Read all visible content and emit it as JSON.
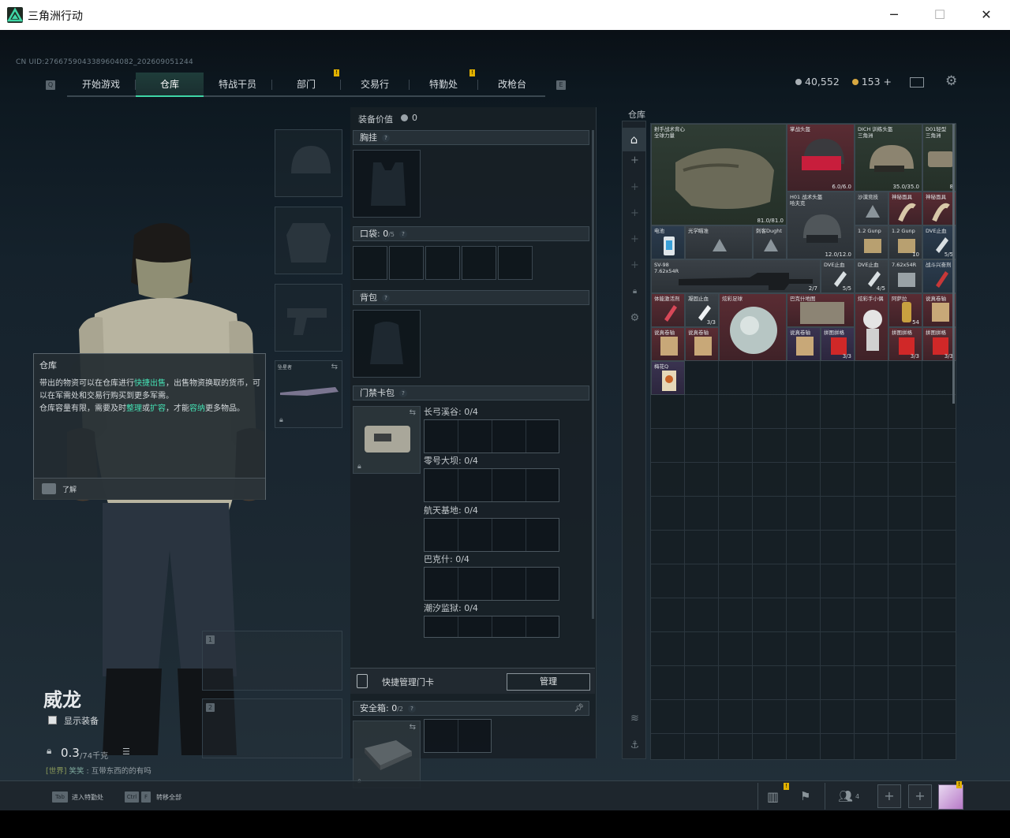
{
  "window": {
    "title": "三角洲行动",
    "minimize": "─",
    "maximize": "☐",
    "close": "✕"
  },
  "uid": "CN UID:2766759043389604082_202609051244",
  "nav": {
    "left_key": "Q",
    "right_key": "E",
    "tabs": [
      "开始游戏",
      "仓库",
      "特战干员",
      "部门",
      "交易行",
      "特勤处",
      "改枪台"
    ],
    "active_tab": "仓库"
  },
  "currency": {
    "coins": "40,552",
    "tokens": "153 +",
    "coin_color": "#a9b0b5",
    "token_color": "#d8a840"
  },
  "character": {
    "name": "威龙",
    "show_equipment": "显示装备",
    "weight": "0.3",
    "weight_max": "/74千克",
    "chat": "[世界] 笑笑 : 互带东西的的有吗",
    "chat_channel": "[世界]",
    "chat_user": "笑笑",
    "chat_msg": ": 互带东西的的有吗",
    "slot_label": "坠星者",
    "weapon_slot_1": "1",
    "weapon_slot_2": "2"
  },
  "tooltip": {
    "title": "仓库",
    "l1a": "带出的物资可以在仓库进行",
    "l1b": "快捷出售",
    "l1c": "，出售物资换取的货币，可以在军需处和交易行购买到更多军需。",
    "l2a": "仓库容量有限，需要及时",
    "l2b": "整理",
    "l2c": "或",
    "l2d": "扩容",
    "l2e": "，才能",
    "l2f": "容纳",
    "l2g": "更多物品。",
    "ack": "了解"
  },
  "center": {
    "equip_value_label": "装备价值",
    "equip_value": "0",
    "chest": "胸挂",
    "pocket_label": "口袋:",
    "pocket_count": "0",
    "pocket_max": "/5",
    "backpack": "背包",
    "keycard_bag": "门禁卡包",
    "maps": [
      {
        "name": "长弓溪谷: 0/4"
      },
      {
        "name": "零号大坝: 0/4"
      },
      {
        "name": "航天基地: 0/4"
      },
      {
        "name": "巴克什: 0/4"
      },
      {
        "name": "潮汐监狱: 0/4"
      }
    ],
    "quick_manage": "快捷管理门卡",
    "manage_btn": "管理",
    "safebox_label": "安全箱:",
    "safebox_count": "0",
    "safebox_max": "/2"
  },
  "warehouse": {
    "title": "仓库",
    "items": [
      {
        "name": "射手战术背心",
        "sub": "全球力量",
        "count": "81.0/81.0",
        "tone": "green"
      },
      {
        "name": "掌战头盔",
        "count": "6.0/6.0",
        "tone": "red"
      },
      {
        "name": "DICH 训练头盔",
        "sub": "三角洲",
        "count": "35.0/35.0",
        "tone": "green"
      },
      {
        "name": "D01轻型",
        "sub": "三角洲",
        "count": "8",
        "tone": "green"
      },
      {
        "name": "H01 战术头盔",
        "sub": "哈夫克",
        "count": "12.0/12.0",
        "tone": "gray"
      },
      {
        "name": "沙漠竞技",
        "count": "",
        "tone": "gray"
      },
      {
        "name": "神秘面具",
        "count": "",
        "tone": "red"
      },
      {
        "name": "神秘面具",
        "count": "",
        "tone": "red"
      },
      {
        "name": "电池",
        "count": "",
        "tone": "blue"
      },
      {
        "name": "光学瞄准",
        "count": "",
        "tone": "gray"
      },
      {
        "name": "刺客Dught",
        "count": "",
        "tone": "gray"
      },
      {
        "name": "1.2 Gunp",
        "count": "",
        "tone": "gray"
      },
      {
        "name": "1.2 Gunp",
        "count": "10",
        "tone": "gray"
      },
      {
        "name": "DVE止血",
        "count": "5/5",
        "tone": "blue"
      },
      {
        "name": "SV-98",
        "sub": "7.62x54R",
        "count": "2/7",
        "tone": "gray"
      },
      {
        "name": "DVE止血",
        "count": "5/5",
        "tone": "gray"
      },
      {
        "name": "DVE止血",
        "count": "4/5",
        "tone": "gray"
      },
      {
        "name": "7.62x54R",
        "count": "",
        "tone": "gray"
      },
      {
        "name": "战斗兴奋剂",
        "count": "",
        "tone": "blue"
      },
      {
        "name": "体能激活剂",
        "count": "",
        "tone": "red"
      },
      {
        "name": "凝固止血",
        "count": "3/3",
        "tone": "gray"
      },
      {
        "name": "炫彩足球",
        "count": "",
        "tone": "red"
      },
      {
        "name": "巴克什地图",
        "count": "",
        "tone": "red"
      },
      {
        "name": "炫彩手小偶",
        "count": "",
        "tone": "red"
      },
      {
        "name": "阿萨拉",
        "count": "54",
        "tone": "red"
      },
      {
        "name": "说真卷轴",
        "count": "",
        "tone": "red"
      },
      {
        "name": "说真卷轴",
        "count": "",
        "tone": "red"
      },
      {
        "name": "说真卷轴",
        "count": "",
        "tone": "red"
      },
      {
        "name": "说真卷轴",
        "count": "",
        "tone": "purple"
      },
      {
        "name": "拼图拼格",
        "count": "3/3",
        "tone": "purple"
      },
      {
        "name": "拼图拼格",
        "count": "3/3",
        "tone": "red"
      },
      {
        "name": "拼图拼格",
        "count": "3/3",
        "tone": "red"
      },
      {
        "name": "梅花Q",
        "count": "",
        "tone": "purple"
      }
    ]
  },
  "bottom": {
    "tab_key": "Tab",
    "tab_action": "进入特勤处",
    "ctrl_key": "Ctrl",
    "f_key": "F",
    "transfer_action": "转移全部",
    "team_count": "4",
    "plus": "+"
  }
}
